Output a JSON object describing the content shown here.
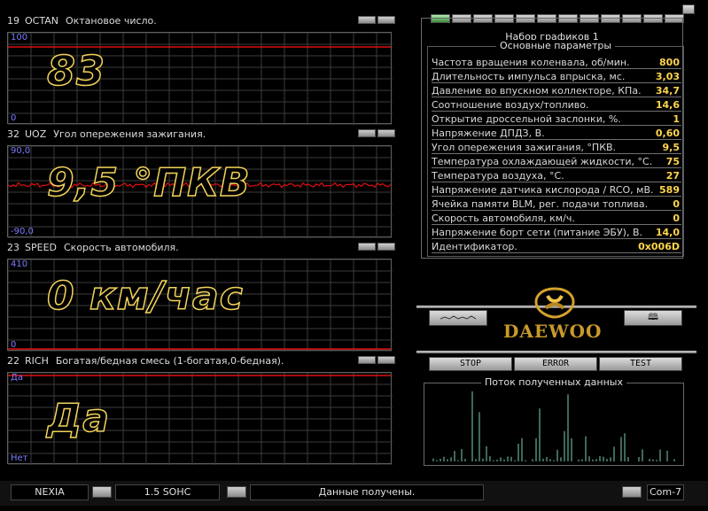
{
  "panels": [
    {
      "num": "19",
      "code": "OCTAN",
      "desc": "Октановое число.",
      "scale_top": "100",
      "scale_bottom": "0",
      "value": "83"
    },
    {
      "num": "32",
      "code": "UOZ",
      "desc": "Угол опережения зажигания.",
      "scale_top": "90,0",
      "scale_bottom": "-90,0",
      "value": "9,5 °ПКВ"
    },
    {
      "num": "23",
      "code": "SPEED",
      "desc": "Скорость автомобиля.",
      "scale_top": "410",
      "scale_bottom": "0",
      "value": "0 км/час"
    },
    {
      "num": "22",
      "code": "RICH",
      "desc": "Богатая/бедная смесь (1-богатая,0-бедная).",
      "scale_top": "Да",
      "scale_bottom": "Нет",
      "value": "Да"
    }
  ],
  "chart_set": {
    "title": "Набор графиков 1"
  },
  "params": {
    "caption": "Основные параметры",
    "rows": [
      {
        "label": "Частота вращения коленвала, об/мин.",
        "value": "800"
      },
      {
        "label": "Длительность импульса впрыска, мс.",
        "value": "3,03"
      },
      {
        "label": "Давление во впускном коллекторе, КПа.",
        "value": "34,7"
      },
      {
        "label": "Соотношение воздух/топливо.",
        "value": "14,6"
      },
      {
        "label": "Открытие дроссельной заслонки, %.",
        "value": "1"
      },
      {
        "label": "Напряжение ДПДЗ, В.",
        "value": "0,60"
      },
      {
        "label": "Угол опережения зажигания, °ПКВ.",
        "value": "9,5"
      },
      {
        "label": "Температура охлаждающей жидкости, °С.",
        "value": "75"
      },
      {
        "label": "Температура воздуха, °С.",
        "value": "27"
      },
      {
        "label": "Напряжение датчика кислорода / RCO, мВ.",
        "value": "589"
      },
      {
        "label": "Ячейка памяти BLM, рег. подачи топлива.",
        "value": "0"
      },
      {
        "label": "Скорость автомобиля, км/ч.",
        "value": "0"
      },
      {
        "label": "Напряжение борт сети (питание ЭБУ), В.",
        "value": "14,0"
      },
      {
        "label": "Идентификатор.",
        "value": "0x006D"
      }
    ]
  },
  "logo": {
    "text": "DAEWOO"
  },
  "controls": {
    "stop": "STOP",
    "error": "ERROR",
    "test": "TEST",
    "book_icon": "book-icon"
  },
  "flow": {
    "caption": "Поток полученных данных"
  },
  "status": {
    "model": "NEXIA",
    "engine": "1.5 SOHC",
    "message": "Данные получены.",
    "port": "Com-7"
  },
  "colors": {
    "accent": "#ffd54a",
    "trace": "#e01010",
    "grid": "#3c3c3c",
    "scale": "#7b7bff",
    "flow": "#7ad0b0"
  }
}
